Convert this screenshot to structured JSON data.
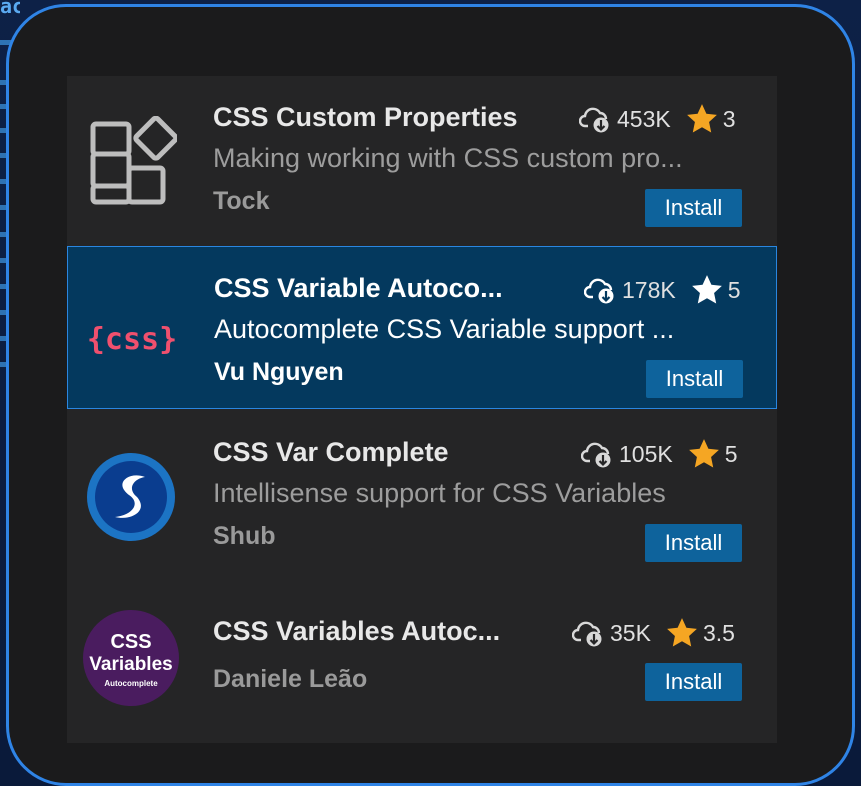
{
  "background": {
    "code_fragment": "acjinxi u"
  },
  "extensions": [
    {
      "name": "CSS Custom Properties",
      "description": "Making working with CSS custom pro...",
      "publisher": "Tock",
      "downloads": "453K",
      "rating": "3",
      "install_label": "Install",
      "icon": "puzzle-blocks-icon",
      "star_color": "#f5a623",
      "selected": false
    },
    {
      "name": "CSS Variable Autoco...",
      "description": "Autocomplete CSS Variable support ...",
      "publisher": "Vu Nguyen",
      "downloads": "178K",
      "rating": "5",
      "install_label": "Install",
      "icon": "css-braces-icon",
      "logo_text": "{css}",
      "star_color": "#ffffff",
      "selected": true
    },
    {
      "name": "CSS Var Complete",
      "description": "Intellisense support for CSS Variables",
      "publisher": "Shub",
      "downloads": "105K",
      "rating": "5",
      "install_label": "Install",
      "icon": "s-swirl-icon",
      "star_color": "#f5a623",
      "selected": false
    },
    {
      "name": "CSS Variables Autoc...",
      "description": "",
      "publisher": "Daniele Leão",
      "downloads": "35K",
      "rating": "3.5",
      "install_label": "Install",
      "icon": "css-variables-badge-icon",
      "logo_lines": [
        "CSS",
        "Variables",
        "Autocomplete"
      ],
      "star_color": "#f5a623",
      "selected": false
    }
  ],
  "colors": {
    "accent_border": "#2f84e6",
    "install_button": "#0e639c",
    "selected_row": "#04395e",
    "star": "#f5a623"
  }
}
